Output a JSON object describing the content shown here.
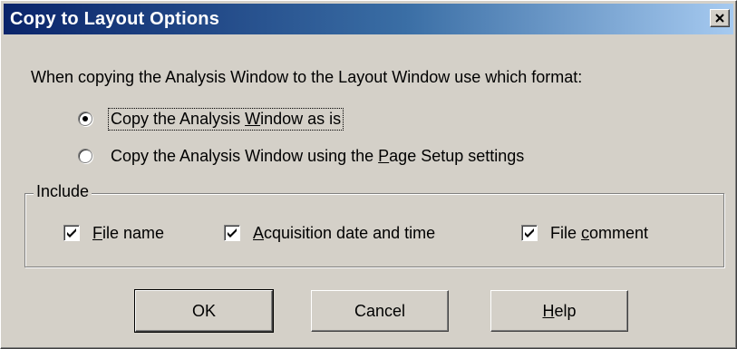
{
  "window": {
    "title": "Copy to Layout Options",
    "close_glyph": "✕"
  },
  "prompt": "When copying the Analysis Window to the Layout Window use which format:",
  "format_options": [
    {
      "pre": "Copy the Analysis Window as is",
      "selected": true
    },
    {
      "pre": "Copy the Analysis Window using the ",
      "hotkey": "P",
      "post": "age Setup settings",
      "selected": false
    }
  ],
  "format_option_0": {
    "pre": "Copy the Analysis ",
    "hotkey": "W",
    "post": "indow as is"
  },
  "include": {
    "label": "Include",
    "items": [
      {
        "hotkey": "F",
        "rest": "ile name",
        "checked": true
      },
      {
        "hotkey": "A",
        "rest": "cquisition date and time",
        "checked": true
      },
      {
        "pre": "File ",
        "hotkey": "c",
        "rest": "omment",
        "checked": true
      }
    ]
  },
  "buttons": {
    "ok": "OK",
    "cancel": "Cancel",
    "help_hotkey": "H",
    "help_rest": "elp"
  },
  "colors": {
    "dialog_bg": "#d4d0c8",
    "title_gradient_start": "#0a246a",
    "title_gradient_end": "#a6caf0"
  }
}
